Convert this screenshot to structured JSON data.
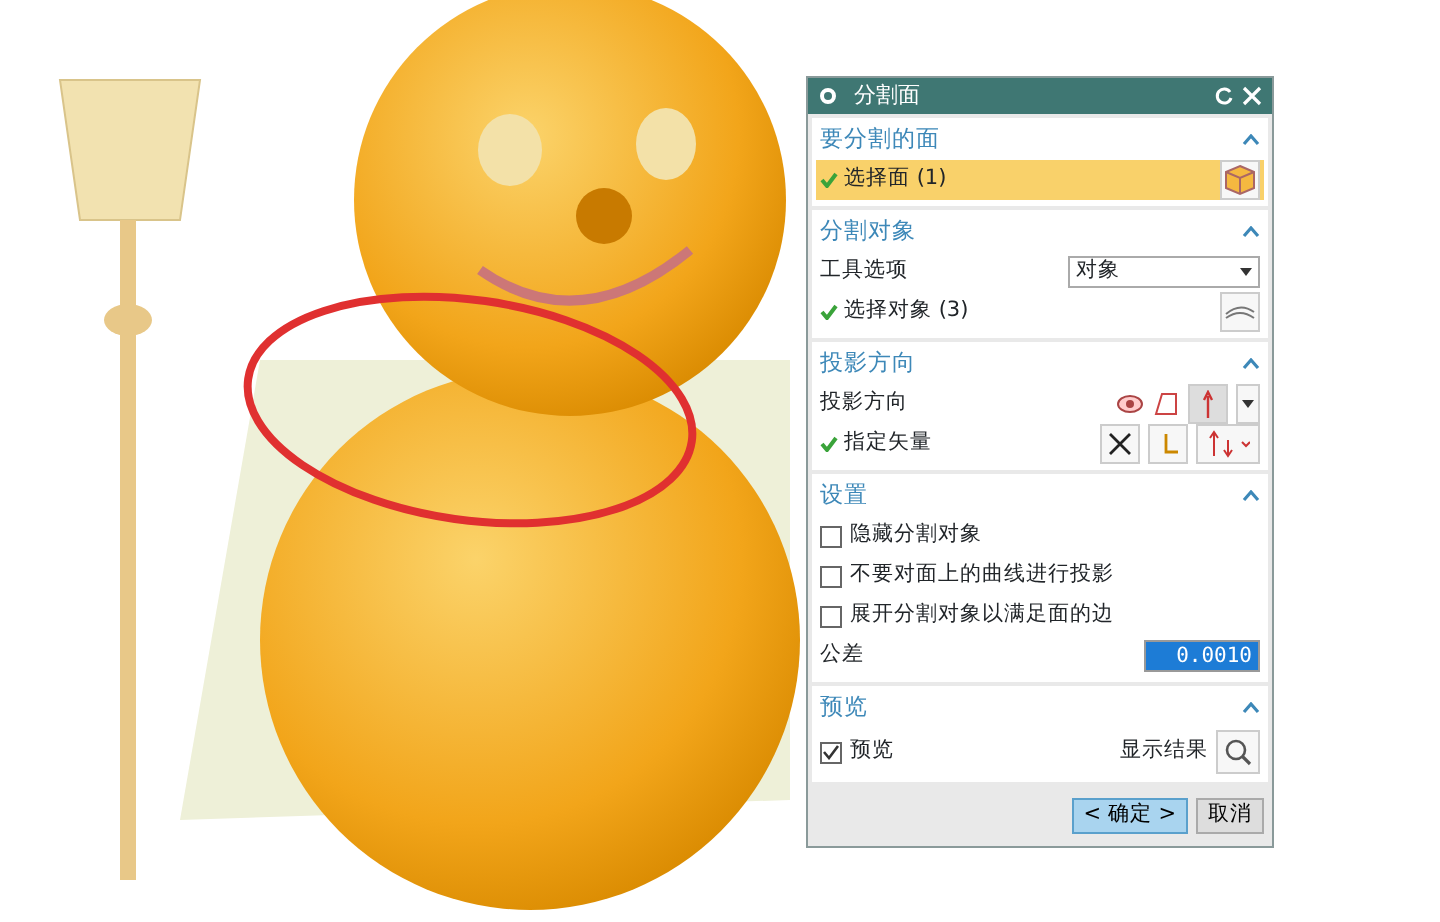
{
  "dialog": {
    "title": "分割面",
    "sections": [
      {
        "title": "要分割的面",
        "expanded": true,
        "rows": [
          {
            "kind": "selection",
            "label": "选择面 (1)",
            "done": true,
            "selected": true
          }
        ]
      },
      {
        "title": "分割对象",
        "expanded": true,
        "rows": [
          {
            "kind": "dropdown",
            "label": "工具选项",
            "value": "对象"
          },
          {
            "kind": "selection",
            "label": "选择对象 (3)",
            "done": true,
            "selected": false
          }
        ]
      },
      {
        "title": "投影方向",
        "expanded": true,
        "rows": [
          {
            "kind": "direction",
            "label": "投影方向"
          },
          {
            "kind": "vector",
            "label": "指定矢量",
            "done": true
          }
        ]
      },
      {
        "title": "设置",
        "expanded": true,
        "rows": [
          {
            "kind": "checkbox",
            "label": "隐藏分割对象",
            "checked": false
          },
          {
            "kind": "checkbox",
            "label": "不要对面上的曲线进行投影",
            "checked": false
          },
          {
            "kind": "checkbox",
            "label": "展开分割对象以满足面的边",
            "checked": false
          },
          {
            "kind": "number",
            "label": "公差",
            "value": "0.0010"
          }
        ]
      },
      {
        "title": "预览",
        "expanded": true,
        "rows": [
          {
            "kind": "preview",
            "label": "预览",
            "checked": true,
            "button": "显示结果"
          }
        ]
      }
    ],
    "buttons": [
      {
        "label": "< 确定 >",
        "default": true
      },
      {
        "label": "取消",
        "default": false
      }
    ]
  }
}
